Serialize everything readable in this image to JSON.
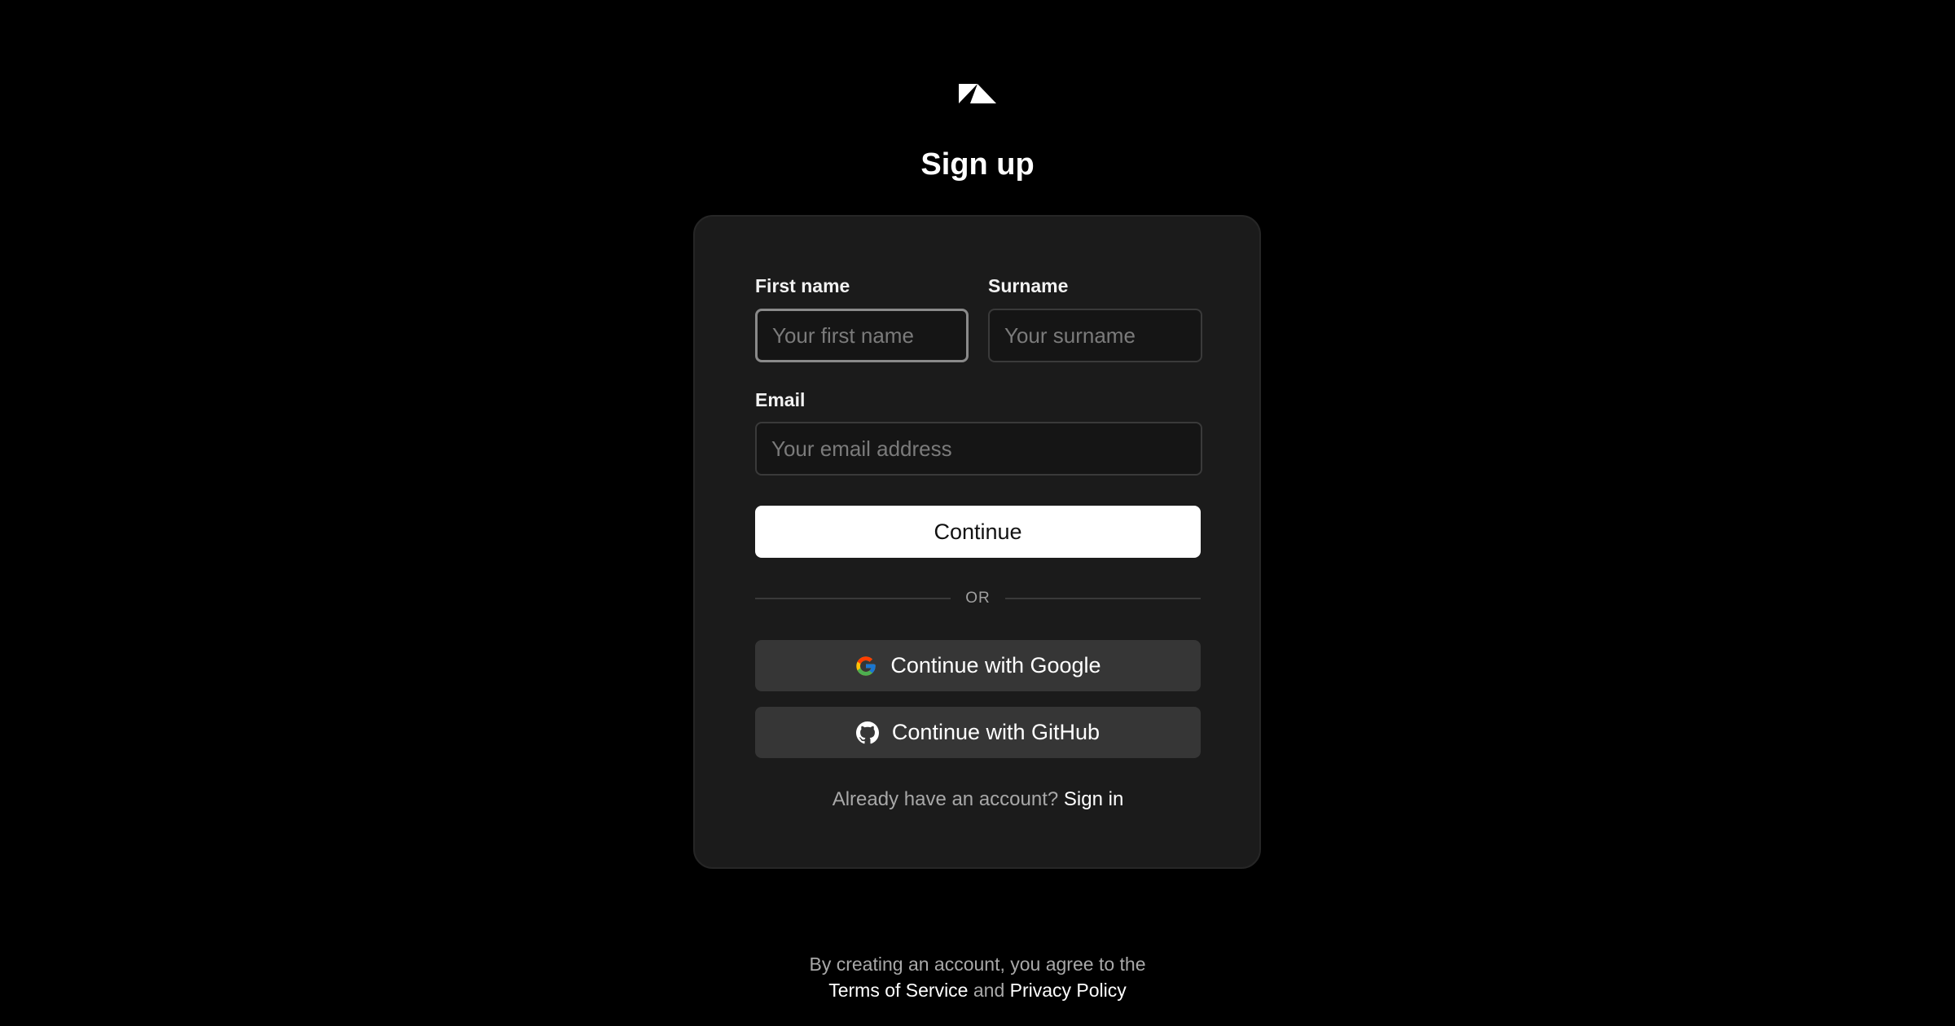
{
  "logo": {
    "icon": "brand-logo-icon"
  },
  "heading": "Sign up",
  "form": {
    "first_name": {
      "label": "First name",
      "placeholder": "Your first name",
      "value": ""
    },
    "surname": {
      "label": "Surname",
      "placeholder": "Your surname",
      "value": ""
    },
    "email": {
      "label": "Email",
      "placeholder": "Your email address",
      "value": ""
    },
    "continue_label": "Continue",
    "divider_text": "OR",
    "google_label": "Continue with Google",
    "github_label": "Continue with GitHub",
    "signin_prompt": "Already have an account?",
    "signin_link": "Sign in"
  },
  "footer": {
    "line1": "By creating an account, you agree to the",
    "terms": "Terms of Service",
    "and": "and",
    "privacy": "Privacy Policy"
  },
  "colors": {
    "background": "#000000",
    "card": "#1b1b1b",
    "primary_button": "#ffffff",
    "secondary_button": "#363636"
  }
}
